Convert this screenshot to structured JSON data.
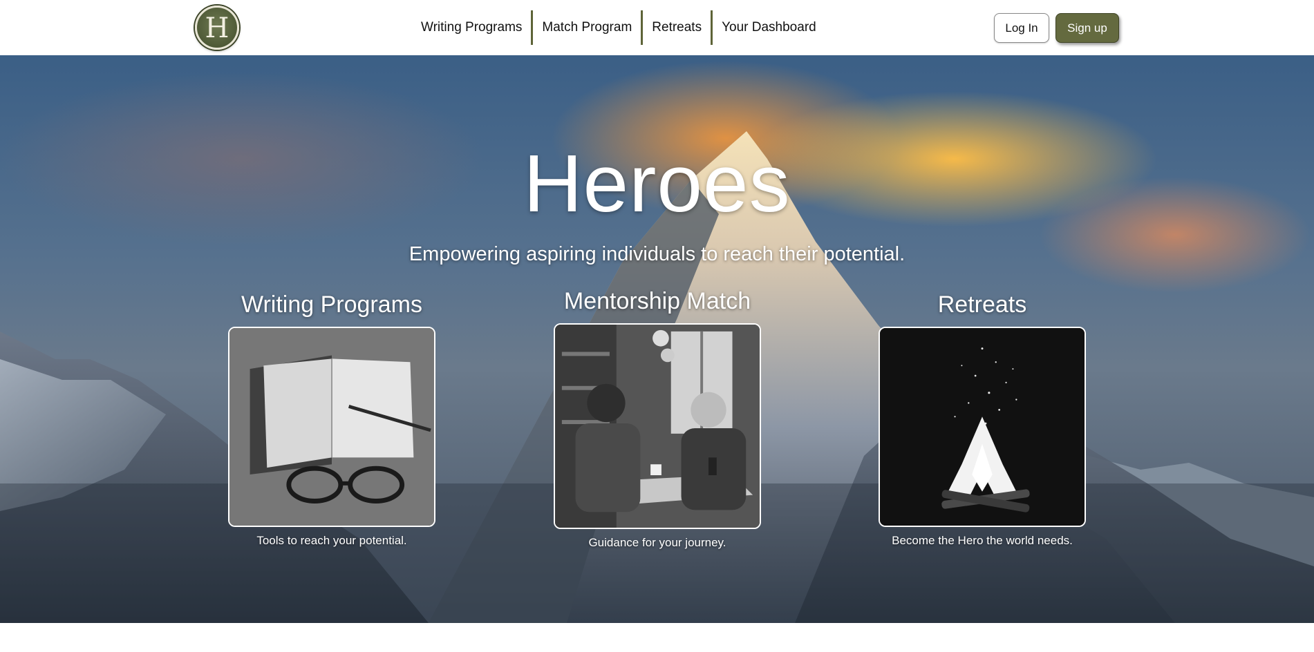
{
  "brand": {
    "logo_letter": "H"
  },
  "nav": {
    "items": [
      {
        "label": "Writing Programs"
      },
      {
        "label": "Match Program"
      },
      {
        "label": "Retreats"
      },
      {
        "label": "Your Dashboard"
      }
    ],
    "accent_color": "#5e6438"
  },
  "auth": {
    "login_label": "Log In",
    "signup_label": "Sign up",
    "signup_color": "#646a3f"
  },
  "hero": {
    "title": "Heroes",
    "subtitle": "Empowering aspiring individuals to reach their potential."
  },
  "cards": [
    {
      "title": "Writing Programs",
      "caption": "Tools to reach your potential.",
      "image": "notebook-glasses-image"
    },
    {
      "title": "Mentorship Match",
      "caption": "Guidance for your journey.",
      "image": "mentor-conversation-image"
    },
    {
      "title": "Retreats",
      "caption": "Become the Hero the world needs.",
      "image": "campfire-image"
    }
  ]
}
